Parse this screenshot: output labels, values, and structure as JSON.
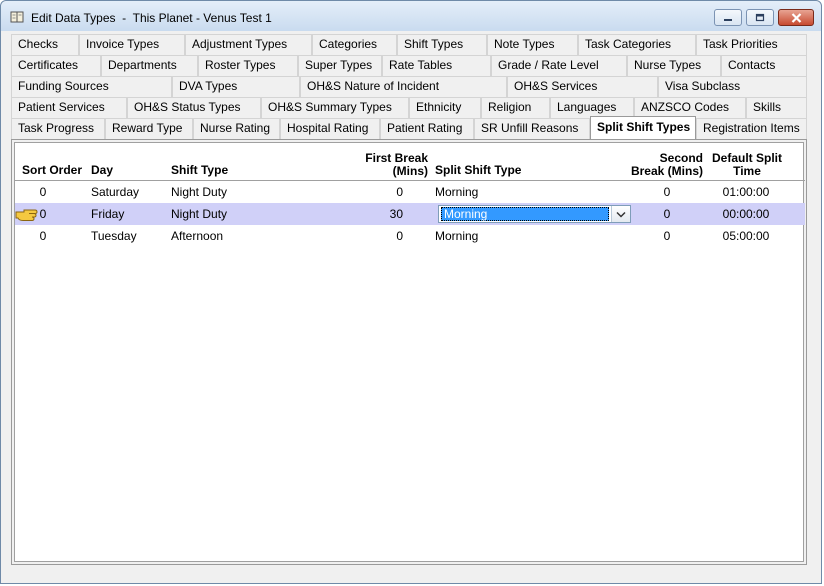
{
  "window": {
    "title": "Edit Data Types  -  This Planet - Venus Test 1"
  },
  "tabs": {
    "row1": [
      "Checks",
      "Invoice Types",
      "Adjustment Types",
      "Categories",
      "Shift Types",
      "Note Types",
      "Task Categories",
      "Task Priorities"
    ],
    "row2": [
      "Certificates",
      "Departments",
      "Roster Types",
      "Super Types",
      "Rate Tables",
      "Grade / Rate Level",
      "Nurse Types",
      "Contacts"
    ],
    "row3": [
      "Funding Sources",
      "DVA Types",
      "OH&S Nature of Incident",
      "OH&S Services",
      "Visa Subclass"
    ],
    "row4": [
      "Patient Services",
      "OH&S Status Types",
      "OH&S Summary Types",
      "Ethnicity",
      "Religion",
      "Languages",
      "ANZSCO Codes",
      "Skills"
    ],
    "row5": [
      "Task Progress",
      "Reward Type",
      "Nurse Rating",
      "Hospital Rating",
      "Patient Rating",
      "SR Unfill Reasons",
      "Split Shift Types",
      "Registration Items"
    ],
    "active": "Split Shift Types"
  },
  "grid": {
    "headers": {
      "sort_order": "Sort Order",
      "day": "Day",
      "shift_type": "Shift Type",
      "first_break_1": "First Break",
      "first_break_2": "(Mins)",
      "split_shift_type": "Split Shift Type",
      "second_break_1": "Second",
      "second_break_2": "Break (Mins)",
      "default_split_1": "Default Split",
      "default_split_2": "Time"
    },
    "rows": [
      {
        "sort_order": "0",
        "day": "Saturday",
        "shift_type": "Night Duty",
        "first_break": "0",
        "split_shift_type": "Morning",
        "second_break": "0",
        "default_split_time": "01:00:00"
      },
      {
        "sort_order": "0",
        "day": "Friday",
        "shift_type": "Night Duty",
        "first_break": "30",
        "split_shift_type": "Morning",
        "second_break": "0",
        "default_split_time": "00:00:00"
      },
      {
        "sort_order": "0",
        "day": "Tuesday",
        "shift_type": "Afternoon",
        "first_break": "0",
        "split_shift_type": "Morning",
        "second_break": "0",
        "default_split_time": "05:00:00"
      }
    ],
    "selected_row": 1
  },
  "icons": {
    "app": "book-icon",
    "row_pointer": "pointing-hand-icon",
    "dropdown": "chevron-down-icon"
  },
  "colors": {
    "selected_row": "#d0d0f8",
    "editor_highlight": "#3399ff",
    "close_button": "#c74a30"
  }
}
